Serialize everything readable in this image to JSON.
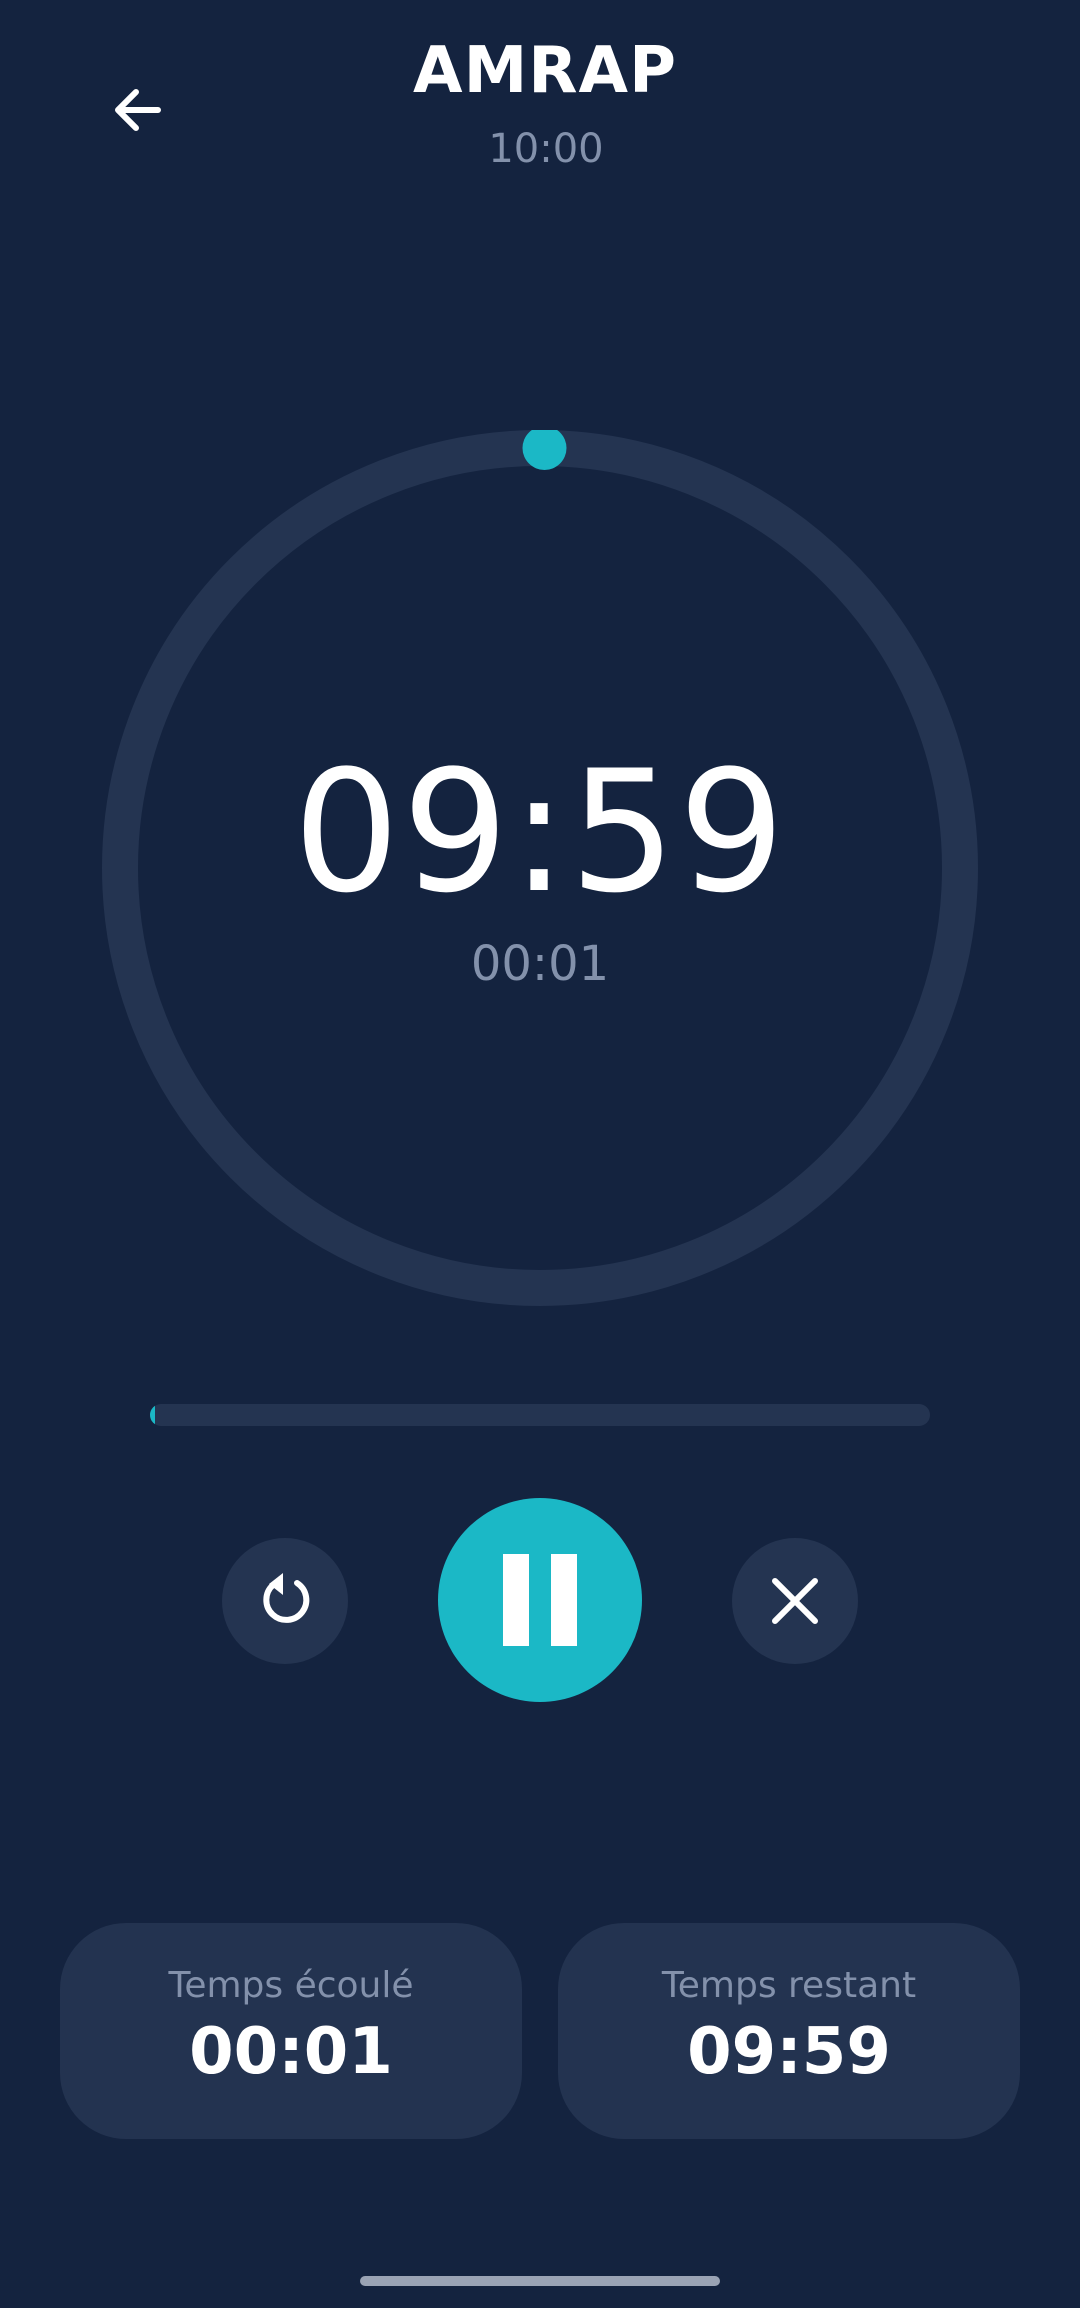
{
  "header": {
    "title": "AMRAP",
    "subtitle": "10:00",
    "back_icon": "arrow-left-icon"
  },
  "timer": {
    "main_time": "09:59",
    "elapsed_small": "00:01",
    "ring_progress": 0.0017,
    "bar_progress": 0.0017
  },
  "controls": {
    "restart_icon": "restart-icon",
    "pause_icon": "pause-icon",
    "stop_icon": "close-icon"
  },
  "stats": {
    "elapsed_label": "Temps écoulé",
    "elapsed_value": "00:01",
    "remaining_label": "Temps restant",
    "remaining_value": "09:59"
  },
  "colors": {
    "background": "#14233f",
    "accent": "#1bb8c6",
    "track": "#243451",
    "card": "#233350",
    "muted_text": "#8391ab"
  }
}
